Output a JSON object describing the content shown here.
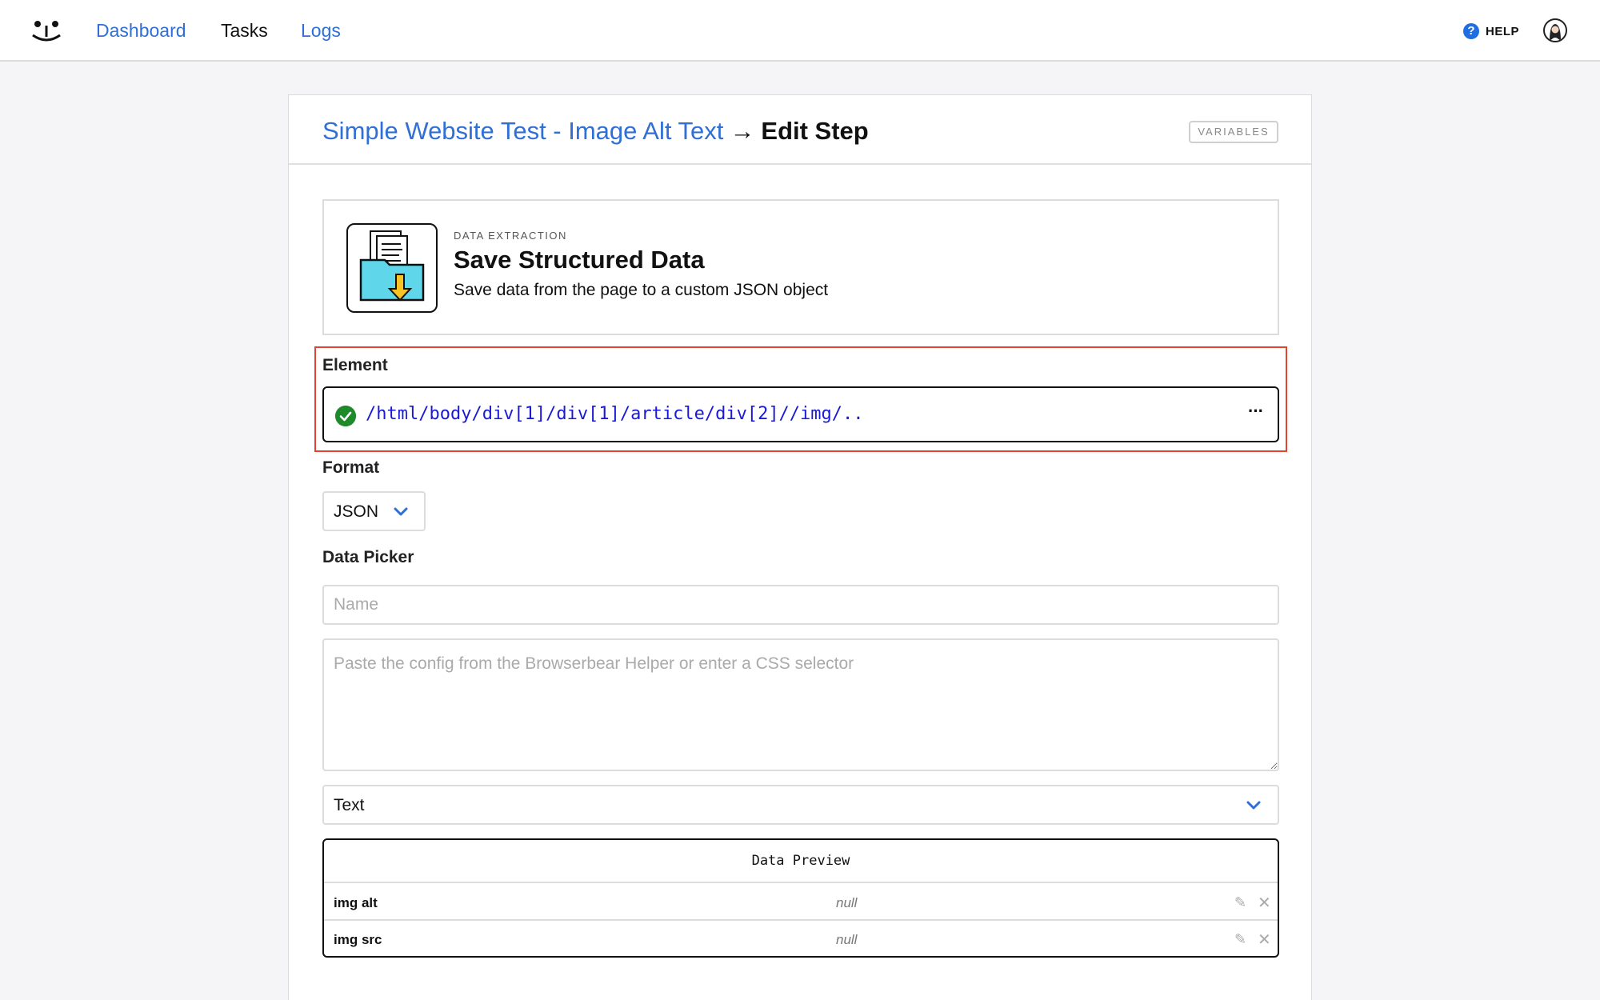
{
  "nav": {
    "logo_icon": "bear-logo-icon",
    "links": [
      "Dashboard",
      "Tasks",
      "Logs"
    ],
    "help_label": "HELP",
    "help_icon": "?"
  },
  "header": {
    "task_name": "Simple Website Test - Image Alt Text",
    "arrow": "→",
    "current": "Edit Step",
    "variables_button": "VARIABLES"
  },
  "step": {
    "category": "DATA EXTRACTION",
    "name": "Save Structured Data",
    "description": "Save data from the page to a custom JSON object",
    "icon": "folder-download-icon"
  },
  "element": {
    "label": "Element",
    "path": "/html/body/div[1]/div[1]/article/div[2]//img/..",
    "more": "···",
    "status_icon": "check-circle-icon"
  },
  "format": {
    "label": "Format",
    "value": "JSON"
  },
  "picker": {
    "label": "Data Picker",
    "name_placeholder": "Name",
    "config_placeholder": "Paste the config from the Browserbear Helper or enter a CSS selector",
    "type_value": "Text"
  },
  "preview": {
    "title": "Data Preview",
    "rows": [
      {
        "name": "img alt",
        "value": "null"
      },
      {
        "name": "img src",
        "value": "null"
      }
    ],
    "edit_glyph": "✎",
    "delete_glyph": "✕"
  },
  "colors": {
    "link": "#2f6fd6",
    "highlight": "#e4432d",
    "success": "#1e8a2a",
    "path": "#1a1ad6"
  }
}
